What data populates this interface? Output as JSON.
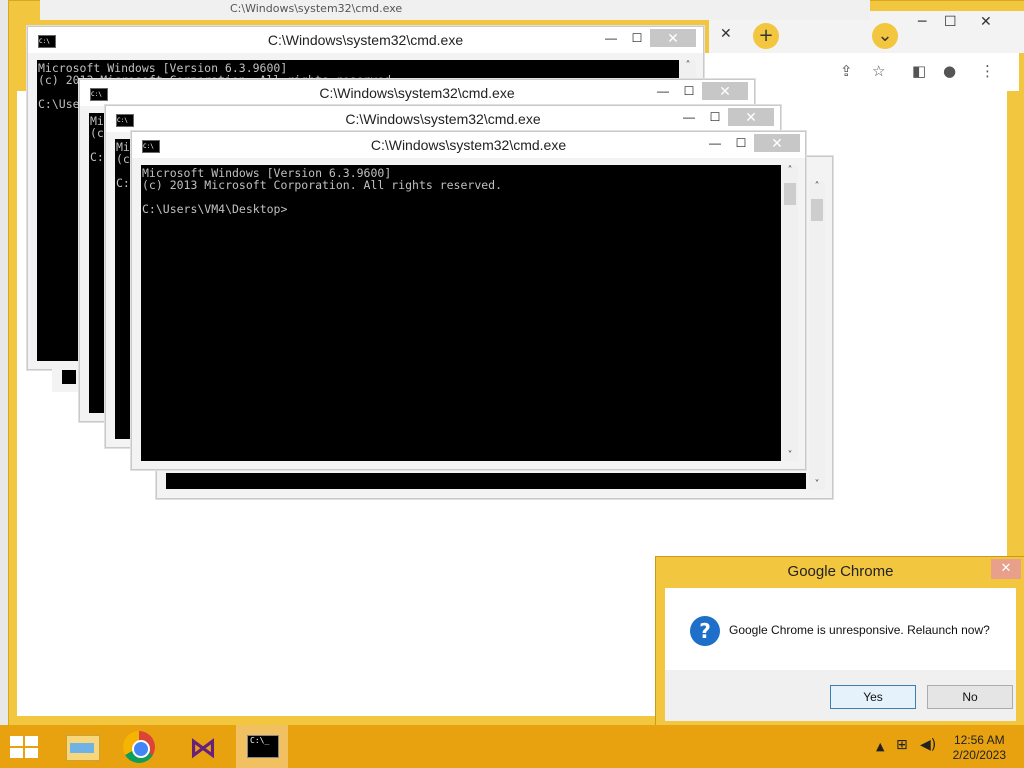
{
  "chrome": {
    "background_title": "C:\\Windows\\system32\\cmd.exe",
    "minimize": "─",
    "maximize": "☐",
    "close": "✕",
    "tab_close": "✕",
    "new_tab": "+",
    "tab_search": "⌄",
    "accent_color": "#f3c63f"
  },
  "cmd_windows": [
    {
      "title": "C:\\Windows\\system32\\cmd.exe",
      "lines": "Microsoft Windows [Version 6.3.9600]\n(c) 2013 Microsoft Corporation. All rights reserved.\n\nC:\\Users\\VM4\\Desktop>"
    },
    {
      "title": "C:\\Windows\\system32\\cmd.exe",
      "lines": "Mi\n(c\n\nC:"
    },
    {
      "title": "C:\\Windows\\system32\\cmd.exe",
      "lines": "Mi\n(c\n\nC:"
    },
    {
      "title": "C:\\Windows\\system32\\cmd.exe",
      "lines": "Microsoft Windows [Version 6.3.9600]\n(c) 2013 Microsoft Corporation. All rights reserved.\n\nC:\\Users\\VM4\\Desktop>"
    }
  ],
  "window_controls": {
    "minimize": "—",
    "maximize": "☐",
    "close": "✕"
  },
  "scroll": {
    "up": "˄",
    "down": "˅"
  },
  "dialog": {
    "title": "Google Chrome",
    "message": "Google Chrome is unresponsive. Relaunch now?",
    "yes_label": "Yes",
    "no_label": "No",
    "close": "✕",
    "icon": "?"
  },
  "taskbar": {
    "apps": [
      "start-icon",
      "file-explorer-icon",
      "chrome-icon",
      "visual-studio-icon",
      "cmd-icon"
    ],
    "cmd_icon_text": "C:\\_",
    "time": "12:56 AM",
    "date": "2/20/2023"
  }
}
